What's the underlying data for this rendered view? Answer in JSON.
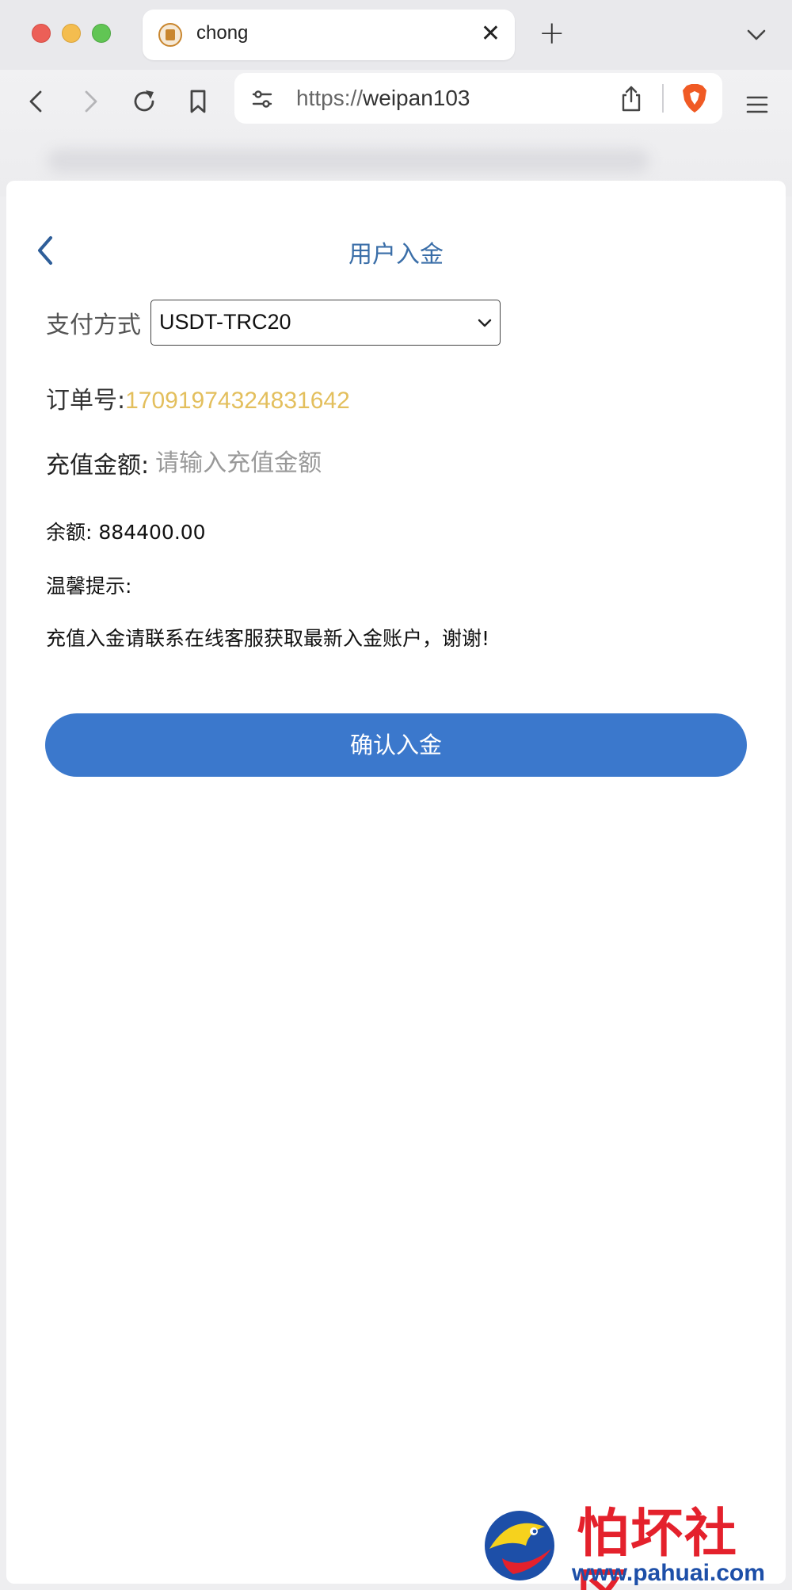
{
  "browser": {
    "tab_title": "chong",
    "new_tab_symbol": "+",
    "close_symbol": "✕",
    "address_protocol": "https://",
    "address_host": "weipan103",
    "icons": [
      "back-icon",
      "forward-icon",
      "reload-icon",
      "bookmark-icon",
      "site-settings-icon",
      "share-icon",
      "brave-shield-icon",
      "menu-icon",
      "tab-list-chevron-icon"
    ]
  },
  "page": {
    "title": "用户入金",
    "payment_label": "支付方式",
    "payment_selected": "USDT-TRC20",
    "order_label": "订单号:",
    "order_number": "17091974324831642",
    "amount_label": "充值金额:",
    "amount_placeholder": "请输入充值金额",
    "amount_value": "",
    "balance_label": "余额:",
    "balance_value": "884400.00",
    "tip_title": "温馨提示:",
    "tip_text": "充值入金请联系在线客服获取最新入金账户，谢谢!",
    "confirm_label": "确认入金"
  },
  "watermark": {
    "title": "怕坏社区",
    "url": "www.pahuai.com"
  },
  "colors": {
    "primary": "#3b78cc",
    "title_blue": "#3a6ea8",
    "order_gold": "#e3bf5d",
    "watermark_red": "#e4212c",
    "watermark_blue": "#1d4fa8"
  }
}
